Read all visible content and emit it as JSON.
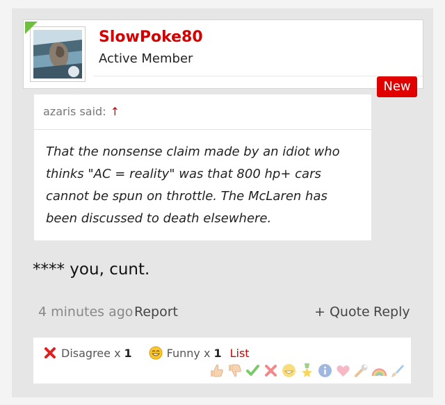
{
  "user": {
    "name": "SlowPoke80",
    "title": "Active Member"
  },
  "badge": {
    "new": "New"
  },
  "quote": {
    "author_label": "azaris said:",
    "arrow": "↑",
    "text": "That the nonsense claim made by an idiot who thinks \"AC = reality\" was that 800 hp+ cars cannot be spun on throttle. The McLaren has been discussed to death elsewhere."
  },
  "message": "**** you, cunt.",
  "meta": {
    "time": "4 minutes ago",
    "report": "Report",
    "quote": "+ Quote",
    "reply": "Reply"
  },
  "ratings": {
    "disagree": {
      "label": "Disagree x",
      "count": "1",
      "icon": "red-x-icon"
    },
    "funny": {
      "label": "Funny x",
      "count": "1",
      "icon": "laughing-face-icon"
    },
    "list_label": "List",
    "bar_icons": [
      "thumbs-up-icon",
      "thumbs-down-icon",
      "check-icon",
      "red-x-icon",
      "laughing-face-icon",
      "star-medal-icon",
      "info-icon",
      "heart-icon",
      "wrench-icon",
      "rainbow-icon",
      "paintbrush-icon"
    ]
  },
  "colors": {
    "accent": "#d40000",
    "badge": "#e00000",
    "background": "#e6e6e6"
  }
}
